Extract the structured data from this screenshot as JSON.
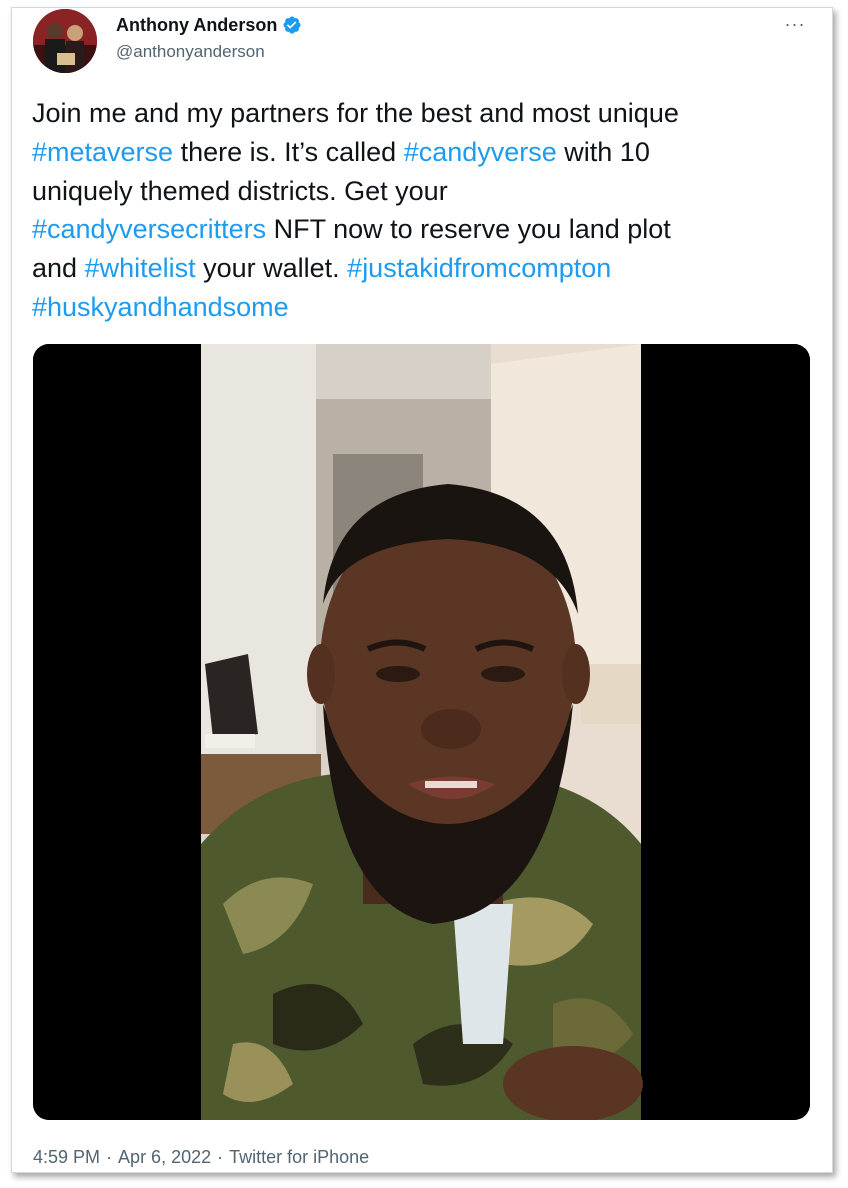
{
  "tweet": {
    "author": {
      "display_name": "Anthony Anderson",
      "handle": "@anthonyanderson",
      "verified": true,
      "verified_icon": "verified-badge-icon",
      "verified_color": "#1d9bf0"
    },
    "more_icon": "more-options-icon",
    "more_label": "···",
    "text_segments": [
      [
        {
          "text": "Join me and my partners for the best and most unique",
          "hashtag": false
        }
      ],
      [
        {
          "text": "#metaverse",
          "hashtag": true
        },
        {
          "text": " there is. It’s called ",
          "hashtag": false
        },
        {
          "text": "#candyverse",
          "hashtag": true
        },
        {
          "text": " with 10",
          "hashtag": false
        }
      ],
      [
        {
          "text": "uniquely themed districts. Get your",
          "hashtag": false
        }
      ],
      [
        {
          "text": "#candyversecritters",
          "hashtag": true
        },
        {
          "text": " NFT now to reserve you land plot",
          "hashtag": false
        }
      ],
      [
        {
          "text": "and ",
          "hashtag": false
        },
        {
          "text": "#whitelist",
          "hashtag": true
        },
        {
          "text": " your wallet. ",
          "hashtag": false
        },
        {
          "text": "#justakidfromcompton",
          "hashtag": true
        }
      ],
      [
        {
          "text": "#huskyandhandsome",
          "hashtag": true
        }
      ]
    ],
    "media": {
      "type": "video",
      "description_icon": "video-thumbnail"
    },
    "time": "4:59 PM",
    "separator": "·",
    "date": "Apr 6, 2022",
    "source": "Twitter for iPhone",
    "colors": {
      "text": "#0f1419",
      "secondary": "#536471",
      "link": "#1d9bf0"
    }
  }
}
